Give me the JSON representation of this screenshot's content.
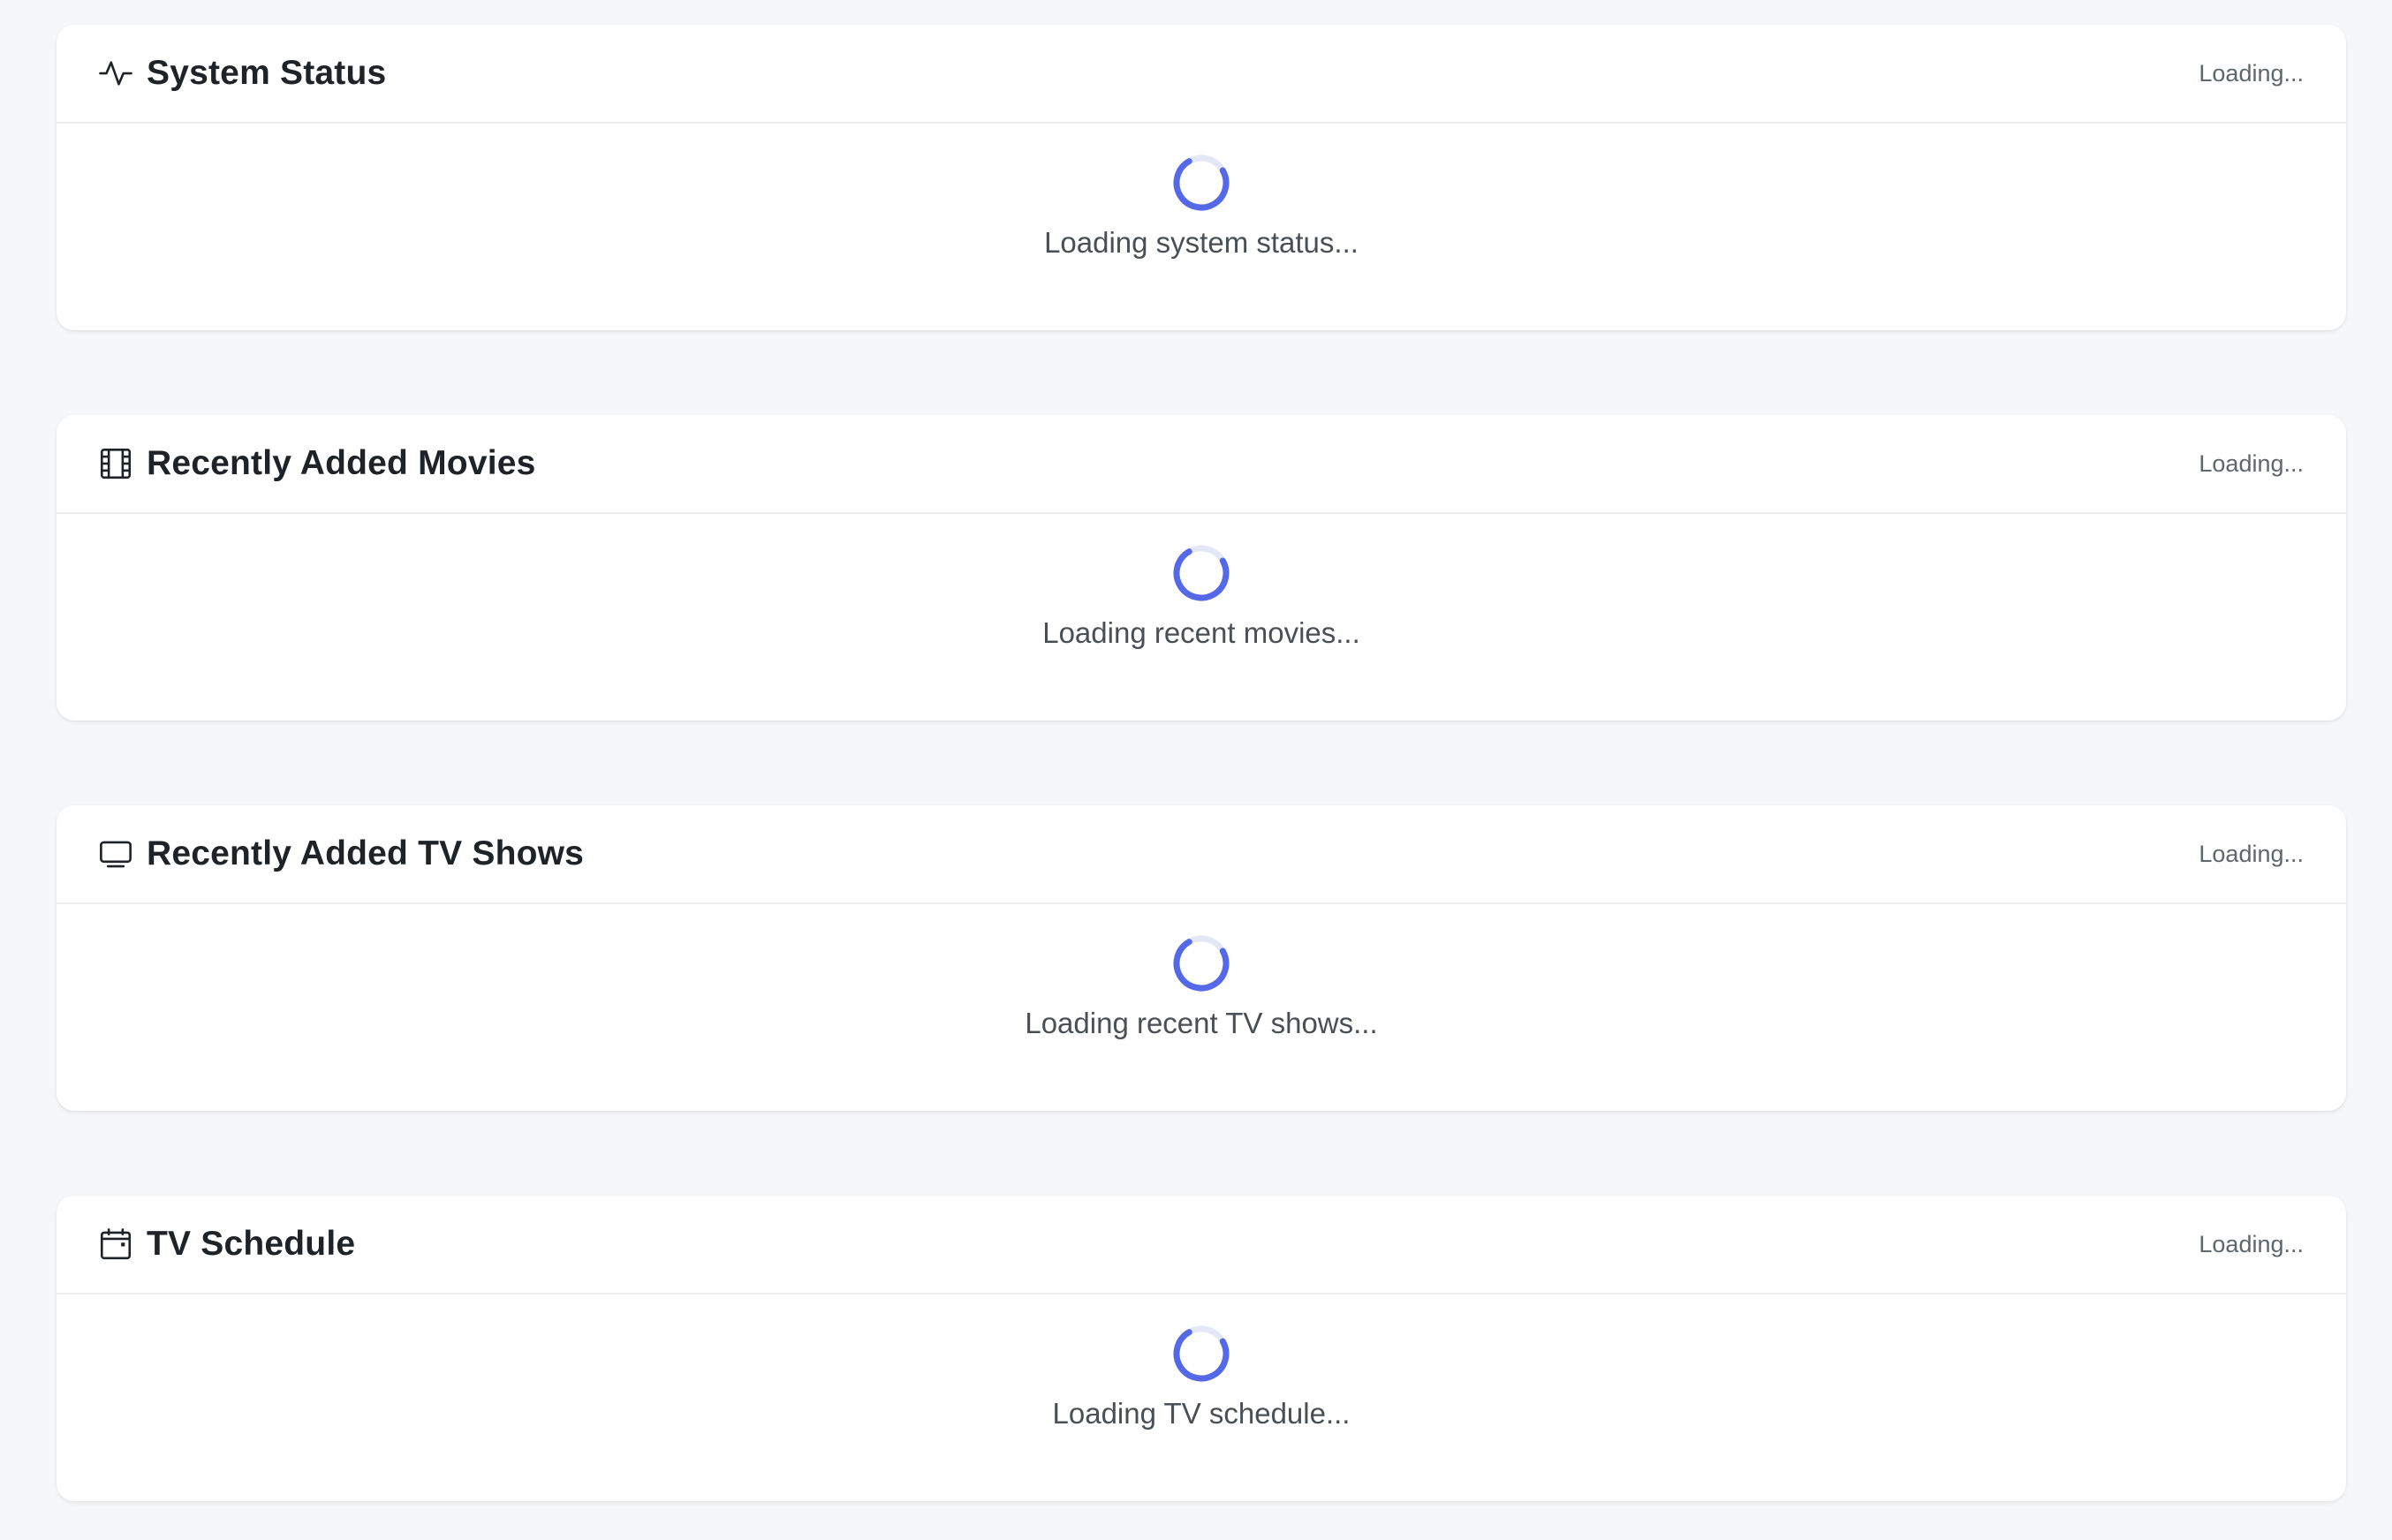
{
  "colors": {
    "background": "#f6f7f9",
    "card": "#ffffff",
    "spinner": "#5468e8",
    "spinner_track": "#e4e7f5"
  },
  "cards": [
    {
      "title": "System Status",
      "icon": "activity-icon",
      "status": "Loading...",
      "loading_text": "Loading system status..."
    },
    {
      "title": "Recently Added Movies",
      "icon": "film-icon",
      "status": "Loading...",
      "loading_text": "Loading recent movies..."
    },
    {
      "title": "Recently Added TV Shows",
      "icon": "tv-icon",
      "status": "Loading...",
      "loading_text": "Loading recent TV shows..."
    },
    {
      "title": "TV Schedule",
      "icon": "calendar-icon",
      "status": "Loading...",
      "loading_text": "Loading TV schedule..."
    }
  ]
}
